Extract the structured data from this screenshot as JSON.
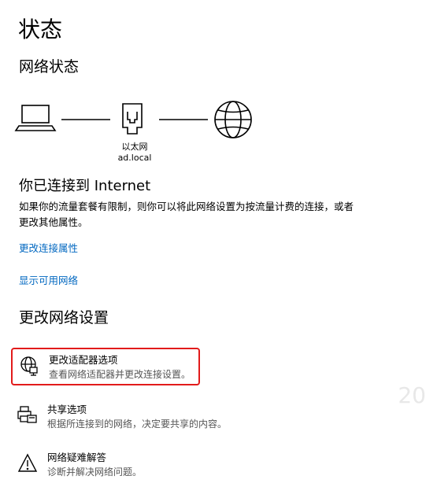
{
  "page": {
    "title": "状态"
  },
  "network_status": {
    "heading": "网络状态",
    "adapter_name": "以太网",
    "domain": "ad.local"
  },
  "connection": {
    "heading": "你已连接到 Internet",
    "description": "如果你的流量套餐有限制，则你可以将此网络设置为按流量计费的连接，或者更改其他属性。",
    "links": {
      "change_properties": "更改连接属性",
      "show_networks": "显示可用网络"
    }
  },
  "change_settings": {
    "heading": "更改网络设置",
    "options": [
      {
        "title": "更改适配器选项",
        "description": "查看网络适配器并更改连接设置。",
        "icon": "network-adapter-icon"
      },
      {
        "title": "共享选项",
        "description": "根据所连接到的网络，决定要共享的内容。",
        "icon": "sharing-printer-icon"
      },
      {
        "title": "网络疑难解答",
        "description": "诊断并解决网络问题。",
        "icon": "warning-icon"
      }
    ]
  },
  "watermark": "20",
  "colors": {
    "link": "#0067c0",
    "highlight": "#e21b1b"
  }
}
